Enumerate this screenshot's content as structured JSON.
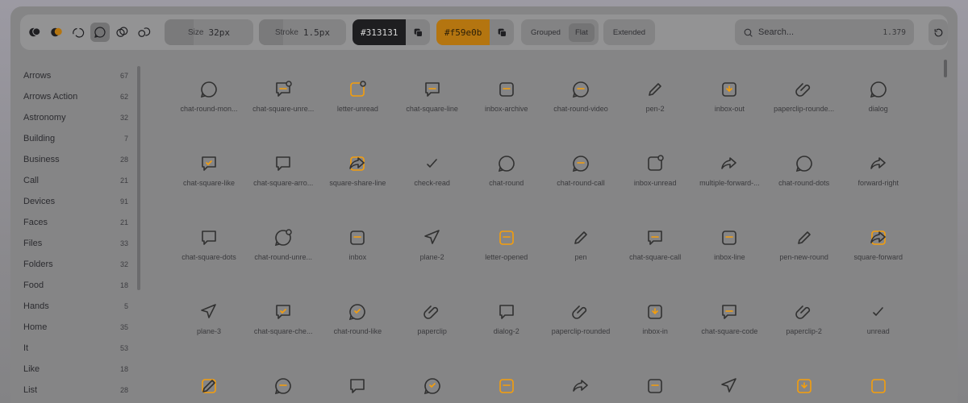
{
  "toolbar": {
    "styles": [
      "bold-icon",
      "bold-duotone-icon",
      "broken-icon",
      "line-duotone-icon",
      "linear-icon",
      "outline-icon"
    ],
    "active_style": 3,
    "size": {
      "label": "Size",
      "value": "32px"
    },
    "stroke": {
      "label": "Stroke",
      "value": "1.5px"
    },
    "primary_color": {
      "hex": "#313131"
    },
    "secondary_color": {
      "hex": "#f59e0b"
    },
    "layout_options": [
      "Grouped",
      "Flat"
    ],
    "active_layout": "Flat",
    "extended_label": "Extended",
    "search": {
      "placeholder": "Search...",
      "count": "1.379"
    }
  },
  "colors": {
    "primary": "#313131",
    "accent": "#f59e0b"
  },
  "categories": [
    {
      "name": "Arrows",
      "count": "67"
    },
    {
      "name": "Arrows Action",
      "count": "62"
    },
    {
      "name": "Astronomy",
      "count": "32"
    },
    {
      "name": "Building",
      "count": "7"
    },
    {
      "name": "Business",
      "count": "28"
    },
    {
      "name": "Call",
      "count": "21"
    },
    {
      "name": "Devices",
      "count": "91"
    },
    {
      "name": "Faces",
      "count": "21"
    },
    {
      "name": "Files",
      "count": "33"
    },
    {
      "name": "Folders",
      "count": "32"
    },
    {
      "name": "Food",
      "count": "18"
    },
    {
      "name": "Hands",
      "count": "5"
    },
    {
      "name": "Home",
      "count": "35"
    },
    {
      "name": "It",
      "count": "53"
    },
    {
      "name": "Like",
      "count": "18"
    },
    {
      "name": "List",
      "count": "28"
    }
  ],
  "icons": [
    [
      "chat-round-mon...",
      "chat-square-unre...",
      "letter-unread",
      "chat-square-line",
      "inbox-archive",
      "chat-round-video",
      "pen-2",
      "inbox-out",
      "paperclip-rounde...",
      "dialog"
    ],
    [
      "chat-square-like",
      "chat-square-arro...",
      "square-share-line",
      "check-read",
      "chat-round",
      "chat-round-call",
      "inbox-unread",
      "multiple-forward-...",
      "chat-round-dots",
      "forward-right"
    ],
    [
      "chat-square-dots",
      "chat-round-unre...",
      "inbox",
      "plane-2",
      "letter-opened",
      "pen",
      "chat-square-call",
      "inbox-line",
      "pen-new-round",
      "square-forward"
    ],
    [
      "plane-3",
      "chat-square-che...",
      "chat-round-like",
      "paperclip",
      "dialog-2",
      "paperclip-rounded",
      "inbox-in",
      "chat-square-code",
      "paperclip-2",
      "unread"
    ],
    [
      "",
      "",
      "",
      "",
      "",
      "",
      "",
      "",
      "",
      ""
    ]
  ]
}
